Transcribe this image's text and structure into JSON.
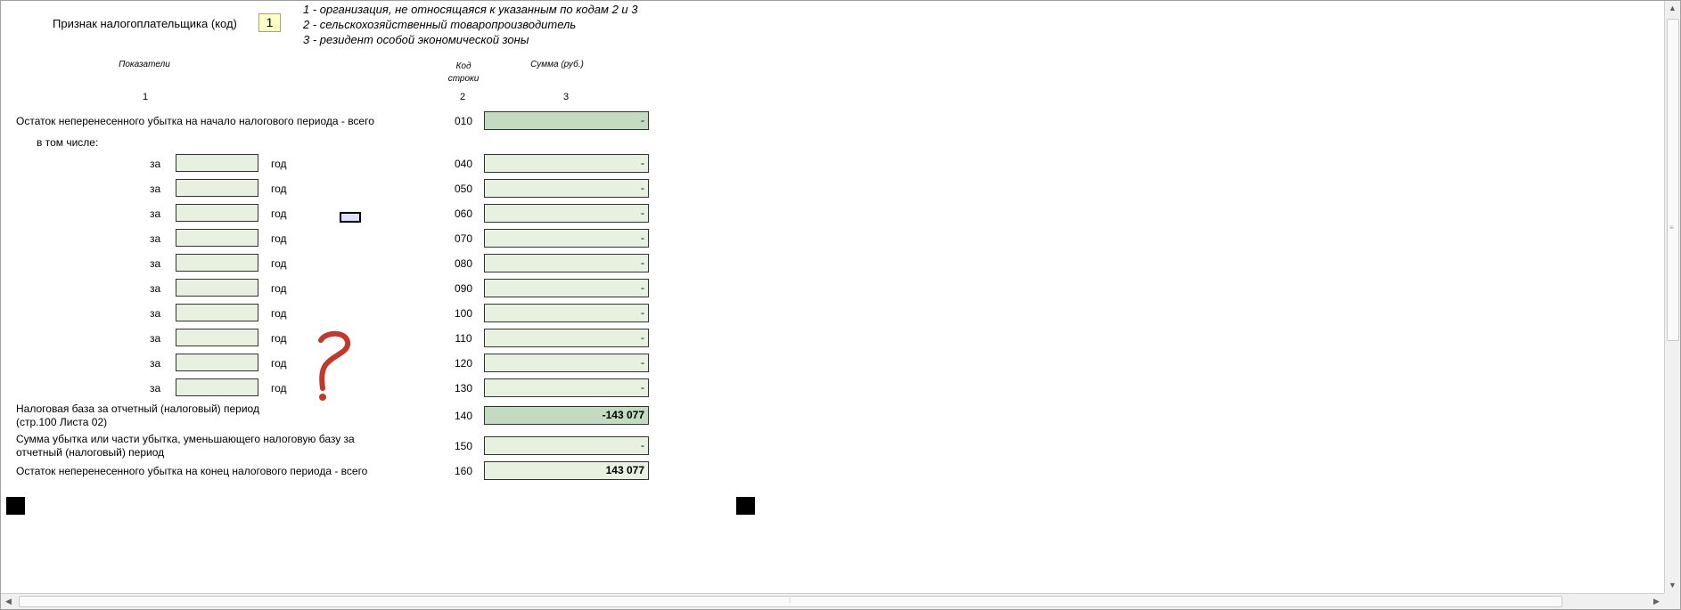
{
  "header": {
    "taxpayer_label": "Признак налогоплательщика (код)",
    "taxpayer_code": "1",
    "legend": [
      "1 - организация, не относящаяся к указанным по кодам 2 и 3",
      "2 - сельскохозяйственный товаропроизводитель",
      "3 - резидент особой экономической зоны"
    ]
  },
  "columns": {
    "indicators": "Показатели",
    "code_line1": "Код",
    "code_line2": "строки",
    "sum": "Сумма (руб.)",
    "num1": "1",
    "num2": "2",
    "num3": "3"
  },
  "row010": {
    "label": "Остаток неперенесенного убытка на начало налогового периода - всего",
    "code": "010",
    "value": "-"
  },
  "incl_label": "в том числе:",
  "year_prefix": "за",
  "year_suffix": "год",
  "year_rows": [
    {
      "code": "040",
      "year": "",
      "value": "-"
    },
    {
      "code": "050",
      "year": "",
      "value": "-"
    },
    {
      "code": "060",
      "year": "",
      "value": "-"
    },
    {
      "code": "070",
      "year": "",
      "value": "-"
    },
    {
      "code": "080",
      "year": "",
      "value": "-"
    },
    {
      "code": "090",
      "year": "",
      "value": "-"
    },
    {
      "code": "100",
      "year": "",
      "value": "-"
    },
    {
      "code": "110",
      "year": "",
      "value": "-"
    },
    {
      "code": "120",
      "year": "",
      "value": "-"
    },
    {
      "code": "130",
      "year": "",
      "value": "-"
    }
  ],
  "row140": {
    "label_line1": "Налоговая база за отчетный (налоговый) период",
    "label_line2": "(стр.100 Листа 02)",
    "code": "140",
    "value": "-143 077"
  },
  "row150": {
    "label_line1": "Сумма убытка или части убытка, уменьшающего налоговую базу за",
    "label_line2": "отчетный (налоговый) период",
    "code": "150",
    "value": "-"
  },
  "row160": {
    "label": "Остаток неперенесенного убытка на конец налогового периода - всего",
    "code": "160",
    "value": "143 077"
  },
  "colors": {
    "input_light": "#e8f1df",
    "input_dark": "#c2dbc1",
    "code_box": "#ffffc8",
    "question_mark": "#c0392b"
  }
}
